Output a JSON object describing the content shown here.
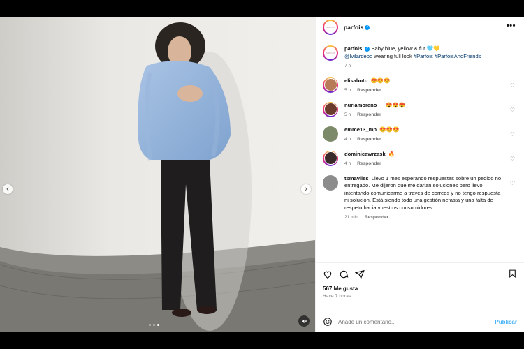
{
  "post": {
    "account": "parfois",
    "avatar_text": "PARFOIS",
    "more_label": "•••",
    "caption": {
      "username": "parfois",
      "text": "Baby blue, yellow & fur 🩵💛",
      "mention": "@lvilardebo",
      "mid_text": " wearing full look ",
      "hashtags": "#Parfois #ParfoisAndFriends",
      "time": "7 h"
    },
    "likes": "567 Me gusta",
    "posted_ago": "Hace 7 horas"
  },
  "comments": [
    {
      "username": "elisaboto",
      "text": "😍😍😍",
      "time": "5 h",
      "reply": "Responder",
      "avatar_color": "#b77b5a",
      "ring": true
    },
    {
      "username": "nuriamoreno__",
      "text": "😍😍😍",
      "time": "5 h",
      "reply": "Responder",
      "avatar_color": "#6b3b2e",
      "ring": true
    },
    {
      "username": "emme13_mp",
      "text": "😍😍😍",
      "time": "4 h",
      "reply": "Responder",
      "avatar_color": "#7c8a6a",
      "ring": false
    },
    {
      "username": "dominicawrzask",
      "text": "🔥",
      "time": "4 h",
      "reply": "Responder",
      "avatar_color": "#3a2a2a",
      "ring": true
    },
    {
      "username": "tsmaviles",
      "text": "Llevo 1 mes esperando respuestas sobre un pedido no entregado. Me dijeron que me darian soluciones pero llevo intentando comunicarme a través de correos y no tengo respuesta ni solución. Está siendo todo una gestión nefasta y una falta de respeto hacia vuestros consumidores.",
      "time": "21 min",
      "reply": "Responder",
      "avatar_color": "#8c8c8c",
      "ring": false
    }
  ],
  "add_comment": {
    "placeholder": "Añade un comentario...",
    "post_label": "Publicar"
  },
  "media": {
    "prev_label": "‹",
    "next_label": "›",
    "slides": 3,
    "active_slide": 3
  }
}
